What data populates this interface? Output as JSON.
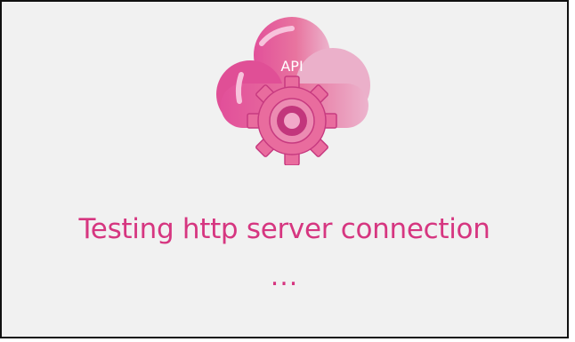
{
  "logo": {
    "icon": "cloud-api-gear-icon",
    "label": "API",
    "colors": {
      "primary": "#e2509a",
      "light": "#ecadcb",
      "dark": "#c73a80"
    }
  },
  "status": {
    "message": "Testing http server connection",
    "ellipsis": "..."
  },
  "colors": {
    "text": "#d63680",
    "background": "#f1f1f1",
    "border": "#111111"
  }
}
